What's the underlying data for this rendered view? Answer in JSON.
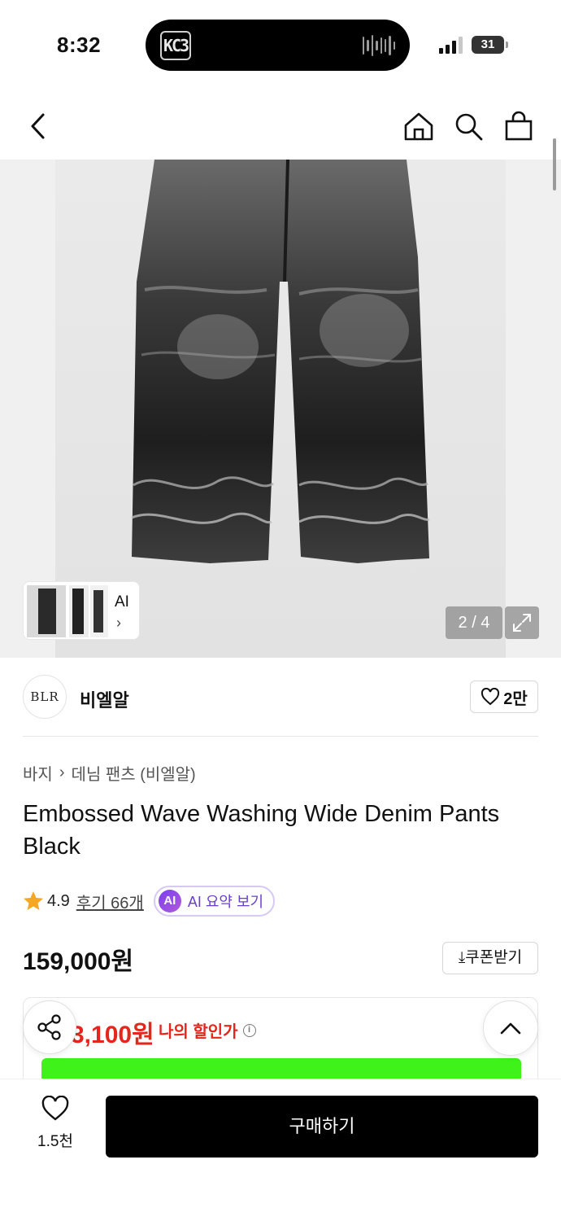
{
  "status_bar": {
    "time": "8:32",
    "battery": "31"
  },
  "product": {
    "image_counter": "2 / 4",
    "ai_thumb_label": "AI",
    "brand": {
      "logo_text": "BLR",
      "name": "비엘알",
      "like_count": "2만"
    },
    "breadcrumb": [
      "바지",
      "데님 팬츠 (비엘알)"
    ],
    "title": "Embossed Wave Washing Wide Denim Pants Black",
    "rating": "4.9",
    "review_link": "후기 66개",
    "ai_summary": {
      "badge": "AI",
      "label": "AI 요약 보기"
    },
    "price": "159,000원",
    "coupon_button": "쿠폰받기",
    "my_price": "3,100원",
    "my_price_label": "나의 할인가"
  },
  "bottom_bar": {
    "wish_count": "1.5천",
    "buy_button": "구매하기"
  },
  "colors": {
    "discount_red": "#e4261c",
    "promo_green": "#3ef21a",
    "ai_purple": "#7b3ff2"
  }
}
